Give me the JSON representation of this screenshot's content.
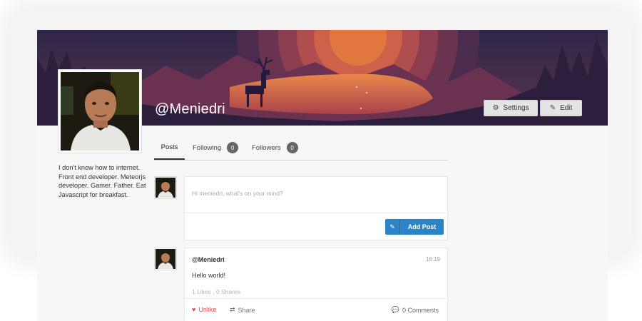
{
  "profile": {
    "username": "@Meniedri",
    "bio": "I don't know how to internet. Front end developer. Meteorjs developer. Gamer. Father. Eat Javascript for breakfast."
  },
  "header": {
    "settings_label": "Settings",
    "edit_label": "Edit",
    "settings_icon": "gear-icon",
    "edit_icon": "brush-icon"
  },
  "tabs": [
    {
      "label": "Posts",
      "active": true
    },
    {
      "label": "Following",
      "count": "0"
    },
    {
      "label": "Followers",
      "count": "0"
    }
  ],
  "composer": {
    "placeholder": "Hi meniedri, what's on your mind?",
    "add_post_label": "Add Post",
    "add_post_icon": "edit-icon"
  },
  "post": {
    "author": "@Meniedri",
    "time": "16:19",
    "text": "Hello world!",
    "stats": "1 Likes , 0 Shares",
    "unlike_label": "Unlike",
    "share_label": "Share",
    "comments_label": "0 Comments"
  },
  "colors": {
    "accent": "#2a84c6",
    "like": "#e8424f",
    "banner_sky": "#3a2c52",
    "banner_sun": "#e07444"
  }
}
